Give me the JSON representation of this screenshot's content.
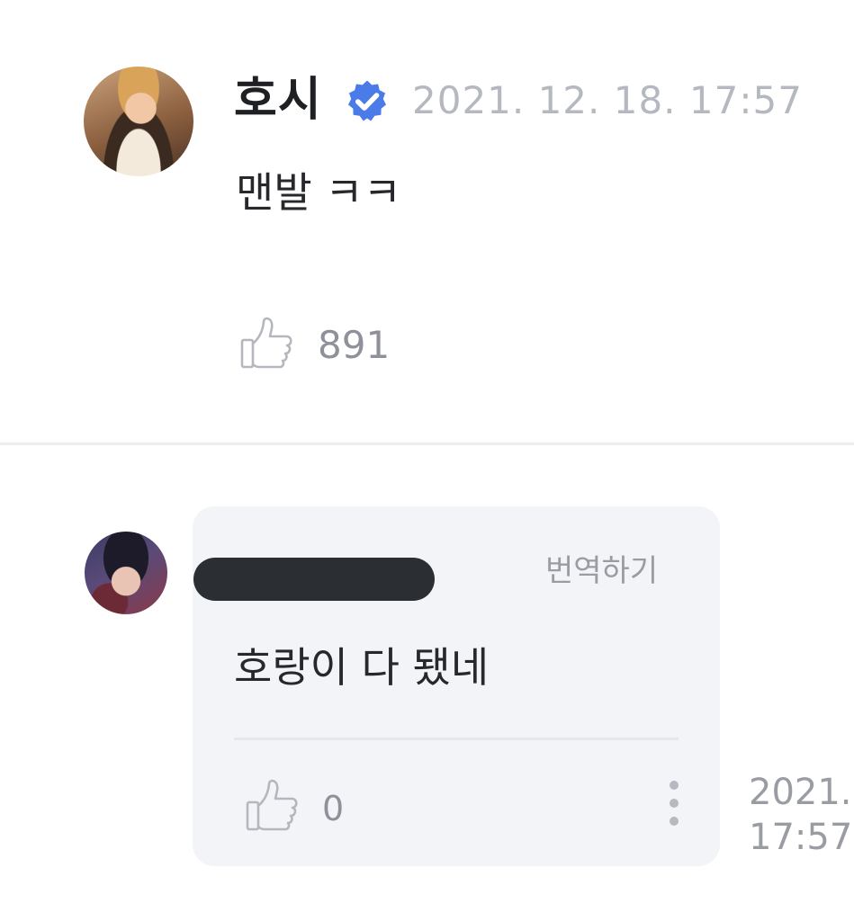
{
  "post": {
    "author_name": "호시",
    "verified_icon": "verified-badge-icon",
    "date": "2021. 12. 18. 17:57",
    "text": "맨발 ㅋㅋ",
    "like_icon": "thumbs-up-icon",
    "like_count": "891"
  },
  "comment": {
    "author_name_redacted": true,
    "translate_label": "번역하기",
    "text": "호랑이 다 됐네",
    "like_icon": "thumbs-up-icon",
    "like_count": "0",
    "more_icon": "more-vertical-icon",
    "date_line1": "2021.",
    "date_line2": "17:57"
  },
  "colors": {
    "verified_blue": "#4a7be8",
    "bubble_bg": "#f3f4f8",
    "muted_text": "#9a9ca3"
  }
}
